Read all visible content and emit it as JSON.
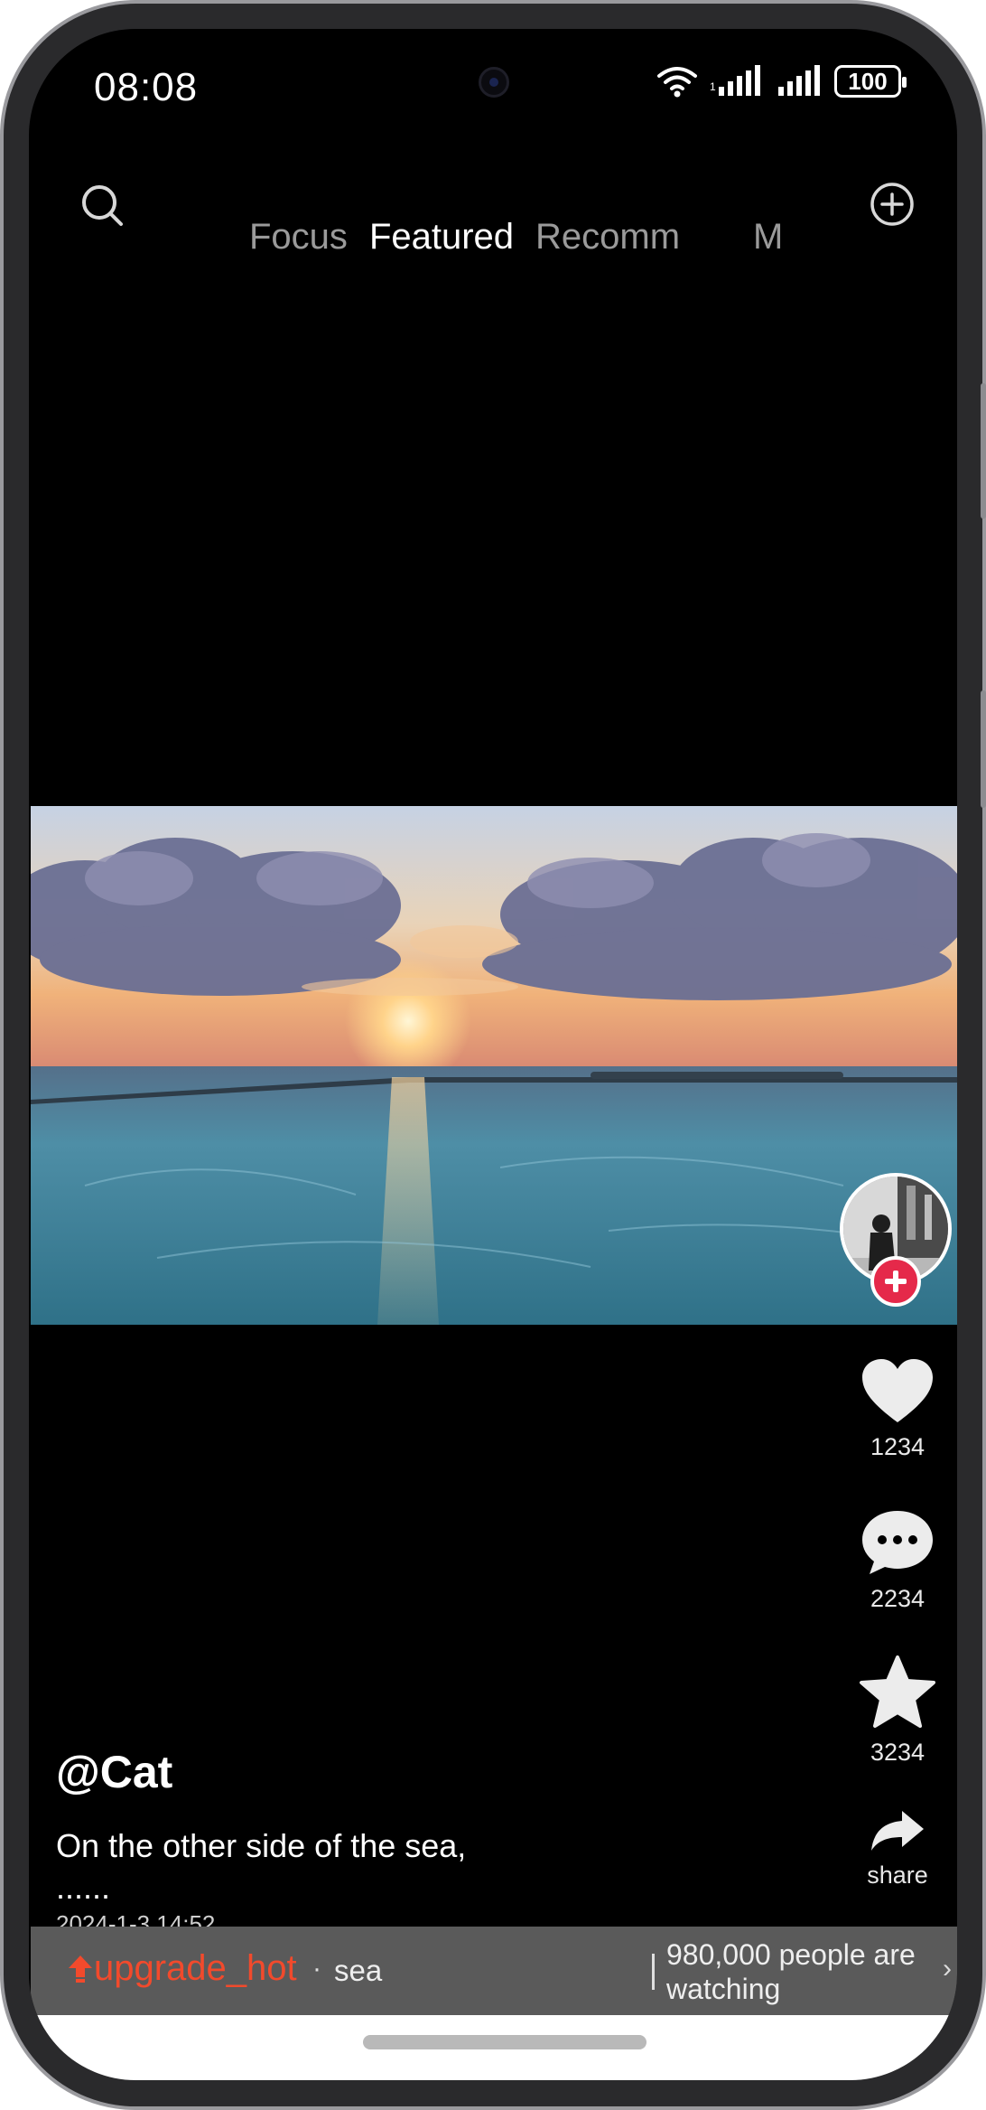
{
  "status_bar": {
    "time": "08:08",
    "battery": "100"
  },
  "top_nav": {
    "tabs": [
      {
        "label": "Focus"
      },
      {
        "label": "Featured"
      },
      {
        "label": "Recomm"
      }
    ],
    "more_tab": "M",
    "icons": {
      "search": "search-icon",
      "add": "add-circle-icon"
    }
  },
  "video": {
    "scene": "ocean-sunset",
    "colors": {
      "sky_top": "#b9c7dc",
      "sun": "#ffd38a",
      "sea": "#3f8aa6"
    }
  },
  "actions": {
    "like_count": "1234",
    "comment_count": "2234",
    "favorite_count": "3234",
    "share_label": "share"
  },
  "post": {
    "author": "@Cat",
    "description": "On the other side of the sea, ......",
    "date": "2024-1-3 14:52"
  },
  "bottom_bar": {
    "hot_label": "upgrade_hot",
    "separator": "·",
    "topic": "sea",
    "watching": "980,000 people are watching",
    "chevron": "›",
    "accent_color": "#f24a2c"
  }
}
